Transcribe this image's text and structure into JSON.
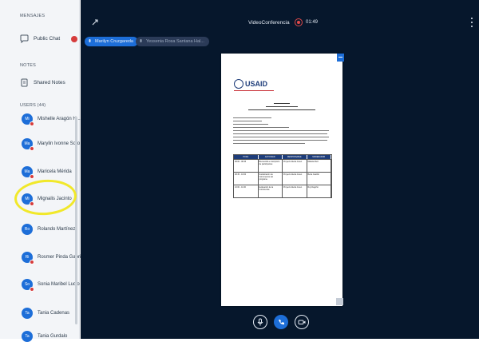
{
  "sidebar": {
    "messages_label": "MENSAJES",
    "public_chat_label": "Public Chat",
    "notes_label": "NOTES",
    "shared_notes_label": "Shared Notes",
    "users_label": "USERS (44)",
    "users": [
      {
        "initials": "Mi",
        "name": "Mishelle Aragón H..."
      },
      {
        "initials": "Ma",
        "name": "Marylin Ivonne Soto"
      },
      {
        "initials": "Ma",
        "name": "Maricela Mérida"
      },
      {
        "initials": "Mi",
        "name": "Mignalis Jacinto"
      },
      {
        "initials": "Ro",
        "name": "Rolando Martínez"
      },
      {
        "initials": "Ri",
        "name": "Rosmer Pinda Gabriel"
      },
      {
        "initials": "So",
        "name": "Sonia Maribel Lucio"
      },
      {
        "initials": "Ta",
        "name": "Tania Cadenas"
      },
      {
        "initials": "Ta",
        "name": "Tania Gurdalo"
      }
    ]
  },
  "header": {
    "title": "VideoConferencia",
    "recording_time": "01:49"
  },
  "talkers": {
    "active": "Marilyn Cruzgareda",
    "idle": "Yessenia Rosa Santana Hal..."
  },
  "slide": {
    "logo_text": "USAID",
    "table_headers": [
      "HORA",
      "ACTIVIDAD",
      "RESPONSABLE",
      "MODERADOR"
    ],
    "table_rows": [
      [
        "08:00 - 08:45",
        "Bienvenida e inscripción de participantes",
        "Proyecto Alerta Joven",
        "Mariela Ruiz"
      ],
      [
        "08:45 - 10:00",
        "Socialización de instrumentos del programa",
        "Proyecto Alerta Joven",
        "Berta Castillo"
      ],
      [
        "10:00 - 11:00",
        "Evaluación de la Conferencia",
        "Proyecto Alerta Joven",
        "Roy Dagoño"
      ]
    ]
  },
  "colors": {
    "accent": "#1d6ed8",
    "alert": "#d63c3c",
    "main_bg": "#06172c",
    "highlight": "#f1e82a"
  }
}
